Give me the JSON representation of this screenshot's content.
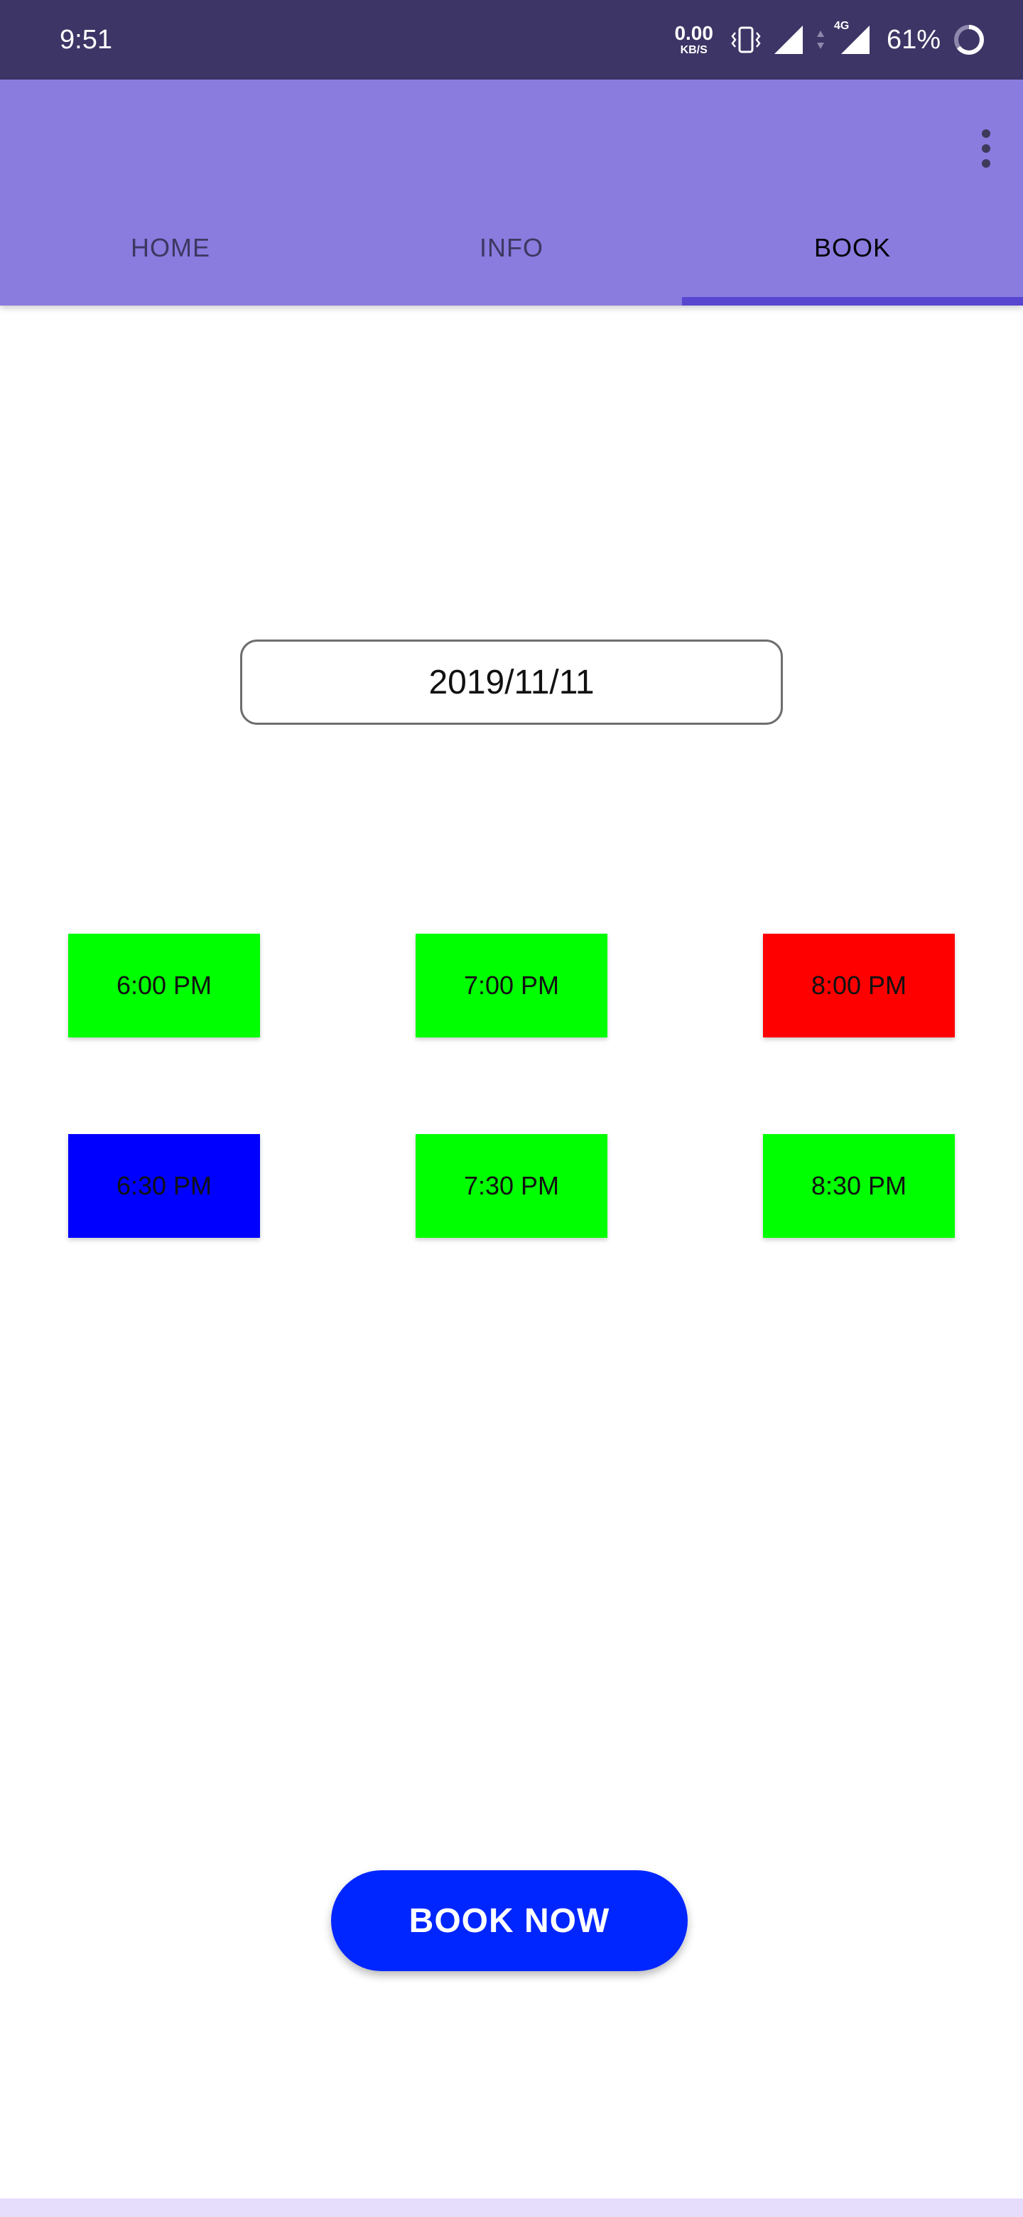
{
  "status_bar": {
    "time": "9:51",
    "net_speed_value": "0.00",
    "net_speed_unit": "KB/S",
    "network_type": "4G",
    "battery_percent": "61%"
  },
  "tabs": [
    {
      "label": "HOME",
      "active": false
    },
    {
      "label": "INFO",
      "active": false
    },
    {
      "label": "BOOK",
      "active": true
    }
  ],
  "date_field": {
    "value": "2019/11/11"
  },
  "time_slots": [
    {
      "label": "6:00 PM",
      "color": "#00ff00"
    },
    {
      "label": "7:00 PM",
      "color": "#00ff00"
    },
    {
      "label": "8:00 PM",
      "color": "#ff0000"
    },
    {
      "label": "6:30 PM",
      "color": "#0000ff"
    },
    {
      "label": "7:30 PM",
      "color": "#00ff00"
    },
    {
      "label": "8:30 PM",
      "color": "#00ff00"
    }
  ],
  "book_button": {
    "label": "BOOK NOW"
  },
  "colors": {
    "status_bar_bg": "#3d3566",
    "app_bar_bg": "#8a7bdf",
    "tab_indicator": "#5846d0",
    "book_button_bg": "#0026ff"
  },
  "icons": {
    "overflow": "more-vert-icon",
    "vibrate": "vibrate-icon",
    "signal": "cell-signal-icon",
    "battery": "battery-ring-icon"
  }
}
